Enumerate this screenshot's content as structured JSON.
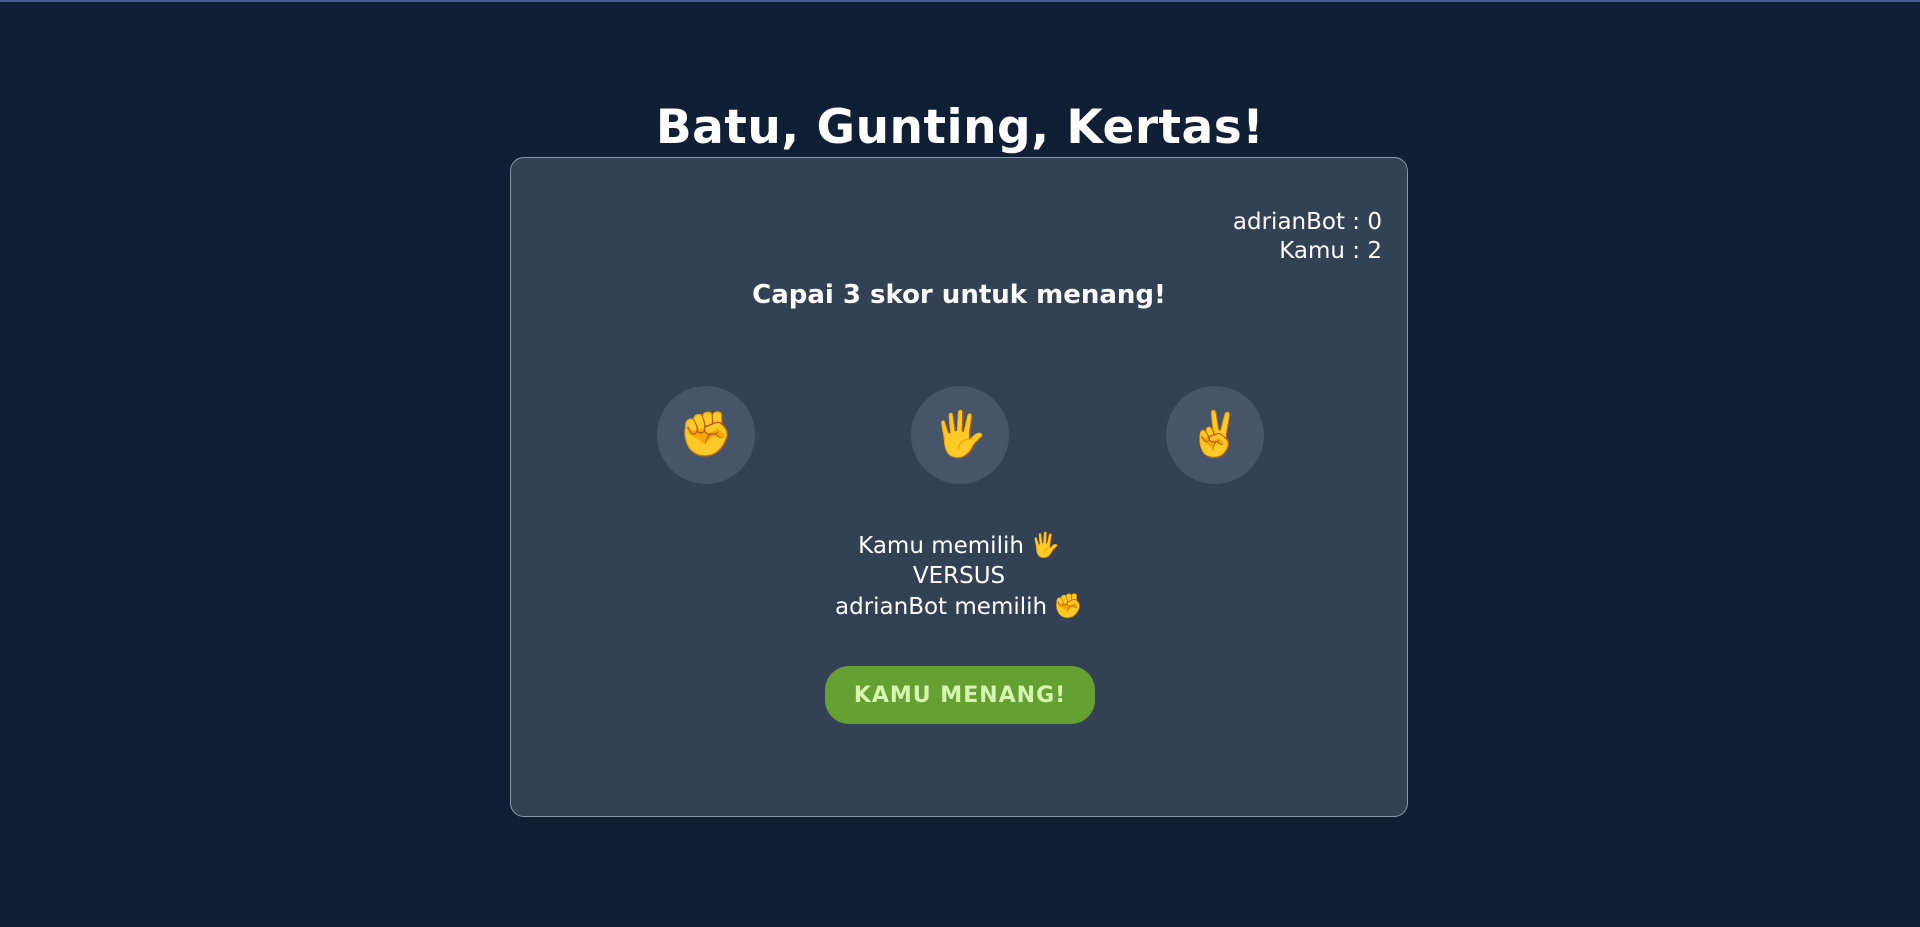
{
  "page": {
    "title": "Batu, Gunting, Kertas!"
  },
  "scoreboard": {
    "bot_label": "adrianBot : 0",
    "player_label": "Kamu : 2"
  },
  "goal_text": "Capai 3 skor untuk menang!",
  "choices": [
    {
      "name": "rock",
      "glyph": "✊",
      "icon": "fist-icon"
    },
    {
      "name": "paper",
      "glyph": "🖐",
      "icon": "hand-icon"
    },
    {
      "name": "scissors",
      "glyph": "✌",
      "icon": "victory-hand-icon"
    }
  ],
  "result": {
    "player_text": "Kamu memilih",
    "player_glyph": "🖐",
    "versus_text": "VERSUS",
    "bot_text": "adrianBot memilih",
    "bot_glyph": "✊"
  },
  "outcome": {
    "label": "KAMU MENANG!",
    "color": "#65a032"
  },
  "colors": {
    "background": "#111f36",
    "card": "#334155",
    "choice_button": "#475569"
  }
}
